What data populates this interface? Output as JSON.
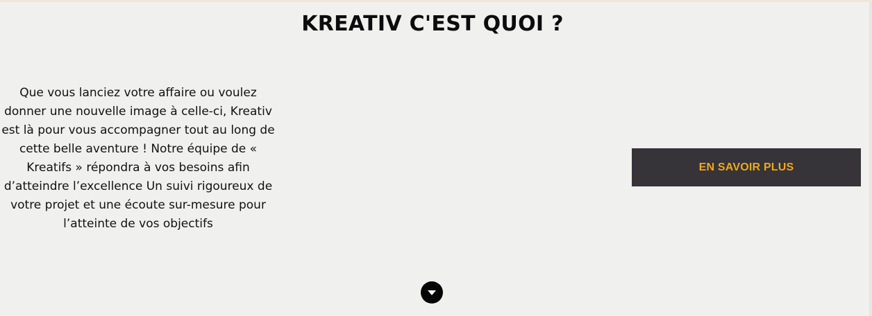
{
  "section": {
    "title": "KREATIV C'EST QUOI ?",
    "description": "Que vous lanciez votre affaire ou voulez donner une nouvelle image à celle-ci, Kreativ est là pour vous accompagner tout au long de cette belle aventure ! Notre équipe de « Kreatifs » répondra à vos besoins afin d’atteindre l’excellence Un suivi rigoureux de votre projet et une écoute sur-mesure pour l’atteinte de vos objectifs",
    "cta_label": "EN SAVOIR PLUS",
    "scroll_icon": "chevron-down-icon"
  },
  "colors": {
    "background": "#f0f0ee",
    "button_bg": "#363438",
    "button_text": "#f2a818",
    "text": "#111111"
  }
}
